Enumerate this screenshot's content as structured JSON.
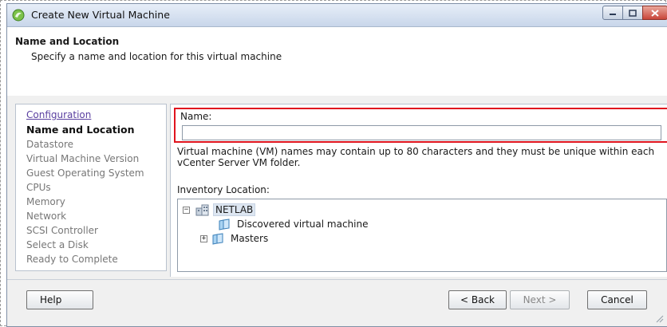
{
  "window": {
    "title": "Create New Virtual Machine"
  },
  "header": {
    "title": "Name and Location",
    "subtitle": "Specify a name and location for this virtual machine"
  },
  "steps": [
    {
      "label": "Configuration",
      "state": "link"
    },
    {
      "label": "Name and Location",
      "state": "current"
    },
    {
      "label": "Datastore",
      "state": "pending"
    },
    {
      "label": "Virtual Machine Version",
      "state": "pending"
    },
    {
      "label": "Guest Operating System",
      "state": "pending"
    },
    {
      "label": "CPUs",
      "state": "pending"
    },
    {
      "label": "Memory",
      "state": "pending"
    },
    {
      "label": "Network",
      "state": "pending"
    },
    {
      "label": "SCSI Controller",
      "state": "pending"
    },
    {
      "label": "Select a Disk",
      "state": "pending"
    },
    {
      "label": "Ready to Complete",
      "state": "pending"
    }
  ],
  "form": {
    "name_label": "Name:",
    "name_value": "",
    "name_hint": "Virtual machine (VM) names may contain up to 80 characters and they must be unique within each vCenter Server VM folder.",
    "inventory_label": "Inventory Location:"
  },
  "tree": {
    "root": {
      "label": "NETLAB",
      "expander": "−",
      "icon": "datacenter-icon"
    },
    "children": [
      {
        "label": "Discovered virtual machine",
        "icon": "folder-icon",
        "expander": ""
      },
      {
        "label": "Masters",
        "icon": "folder-icon",
        "expander": "+"
      }
    ]
  },
  "buttons": {
    "help": "Help",
    "back": "< Back",
    "next": "Next >",
    "cancel": "Cancel"
  },
  "colors": {
    "highlight": "#e0141e",
    "link": "#5a3fa0",
    "close_button": "#c9463a"
  }
}
